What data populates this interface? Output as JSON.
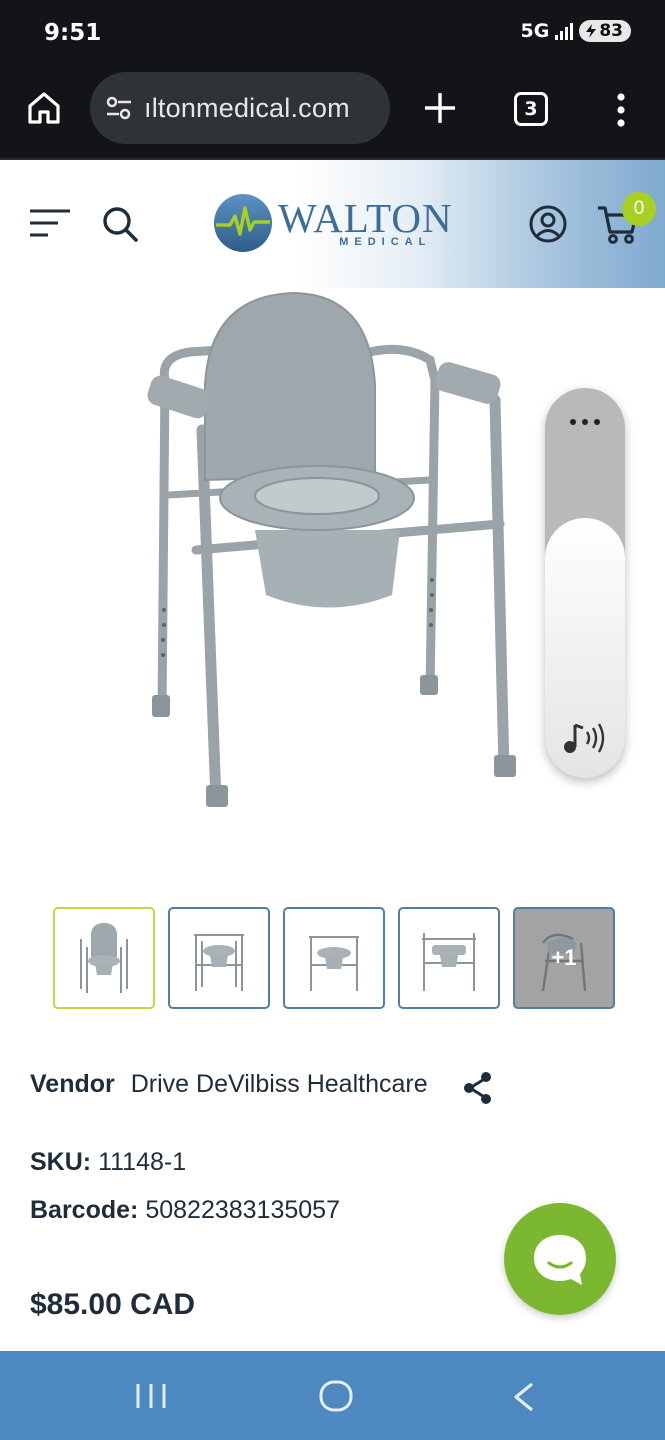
{
  "status_bar": {
    "time": "9:51",
    "network": "5G",
    "battery": "83"
  },
  "browser": {
    "url": "ıltonmedical.com",
    "tab_count": "3",
    "icons": [
      "home-icon",
      "site-settings-icon",
      "new-tab-icon",
      "tab-switcher-icon",
      "more-options-icon"
    ]
  },
  "header": {
    "logo_text": "WALTON",
    "logo_subtext": "MEDICAL",
    "cart_count": "0",
    "accent_color": "#a8cf24",
    "brand_color": "#3d6d99"
  },
  "gallery": {
    "thumbnails": [
      {
        "label": "",
        "active": true
      },
      {
        "label": "",
        "active": false
      },
      {
        "label": "",
        "active": false
      },
      {
        "label": "",
        "active": false
      },
      {
        "label": "+1",
        "active": false
      }
    ]
  },
  "product": {
    "vendor_label": "Vendor",
    "vendor_value": "Drive DeVilbiss Healthcare",
    "sku_label": "SKU:",
    "sku_value": "11148-1",
    "barcode_label": "Barcode:",
    "barcode_value": "50822383135057",
    "price": "$85.00 CAD"
  },
  "chat": {
    "icon": "chat-bubble-icon",
    "color": "#7cb82f"
  },
  "nav_bar": {
    "icons": [
      "recents-icon",
      "home-icon",
      "back-icon"
    ],
    "color": "#4d88c0"
  }
}
